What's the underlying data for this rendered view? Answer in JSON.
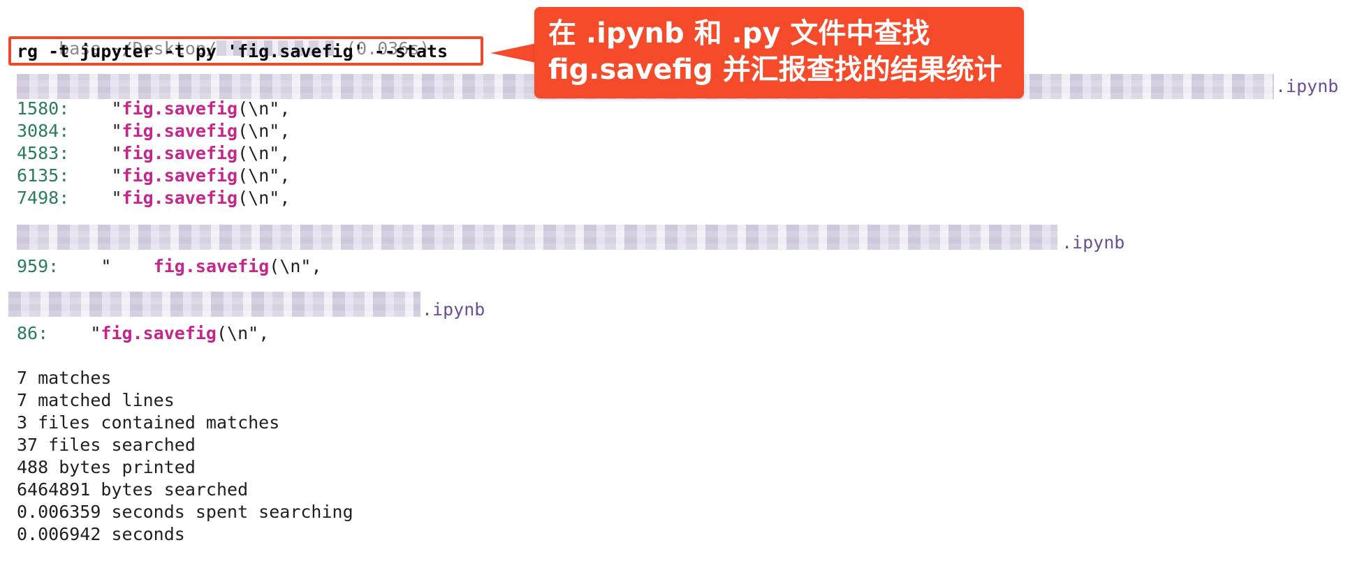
{
  "terminal": {
    "prompt": {
      "prefix": "base ~/Desktop/",
      "suffix": " (0.036s)"
    },
    "command": "rg -t jupyter -t py 'fig.savefig' --stats",
    "files": [
      {
        "ext": ".ipynb",
        "matches": [
          {
            "line": "1580:",
            "pre": "    \"",
            "term": "fig.savefig",
            "post": "(\\n\","
          },
          {
            "line": "3084:",
            "pre": "    \"",
            "term": "fig.savefig",
            "post": "(\\n\","
          },
          {
            "line": "4583:",
            "pre": "    \"",
            "term": "fig.savefig",
            "post": "(\\n\","
          },
          {
            "line": "6135:",
            "pre": "    \"",
            "term": "fig.savefig",
            "post": "(\\n\","
          },
          {
            "line": "7498:",
            "pre": "    \"",
            "term": "fig.savefig",
            "post": "(\\n\","
          }
        ]
      },
      {
        "ext": ".ipynb",
        "matches": [
          {
            "line": "959:",
            "pre": "    \"    ",
            "term": "fig.savefig",
            "post": "(\\n\","
          }
        ]
      },
      {
        "ext": ".ipynb",
        "matches": [
          {
            "line": "86:",
            "pre": "    \"",
            "term": "fig.savefig",
            "post": "(\\n\","
          }
        ]
      }
    ],
    "stats": [
      "7 matches",
      "7 matched lines",
      "3 files contained matches",
      "37 files searched",
      "488 bytes printed",
      "6464891 bytes searched",
      "0.006359 seconds spent searching",
      "0.006942 seconds"
    ]
  },
  "annotation": {
    "line1": "在 .ipynb 和 .py 文件中查找",
    "line2": "fig.savefig 并汇报查找的结果统计"
  },
  "colors": {
    "highlight_border": "#f0492a",
    "callout_bg": "#f54b2a",
    "line_number": "#2a7d5a",
    "match": "#c4268b",
    "file_ext": "#6a4f93"
  }
}
